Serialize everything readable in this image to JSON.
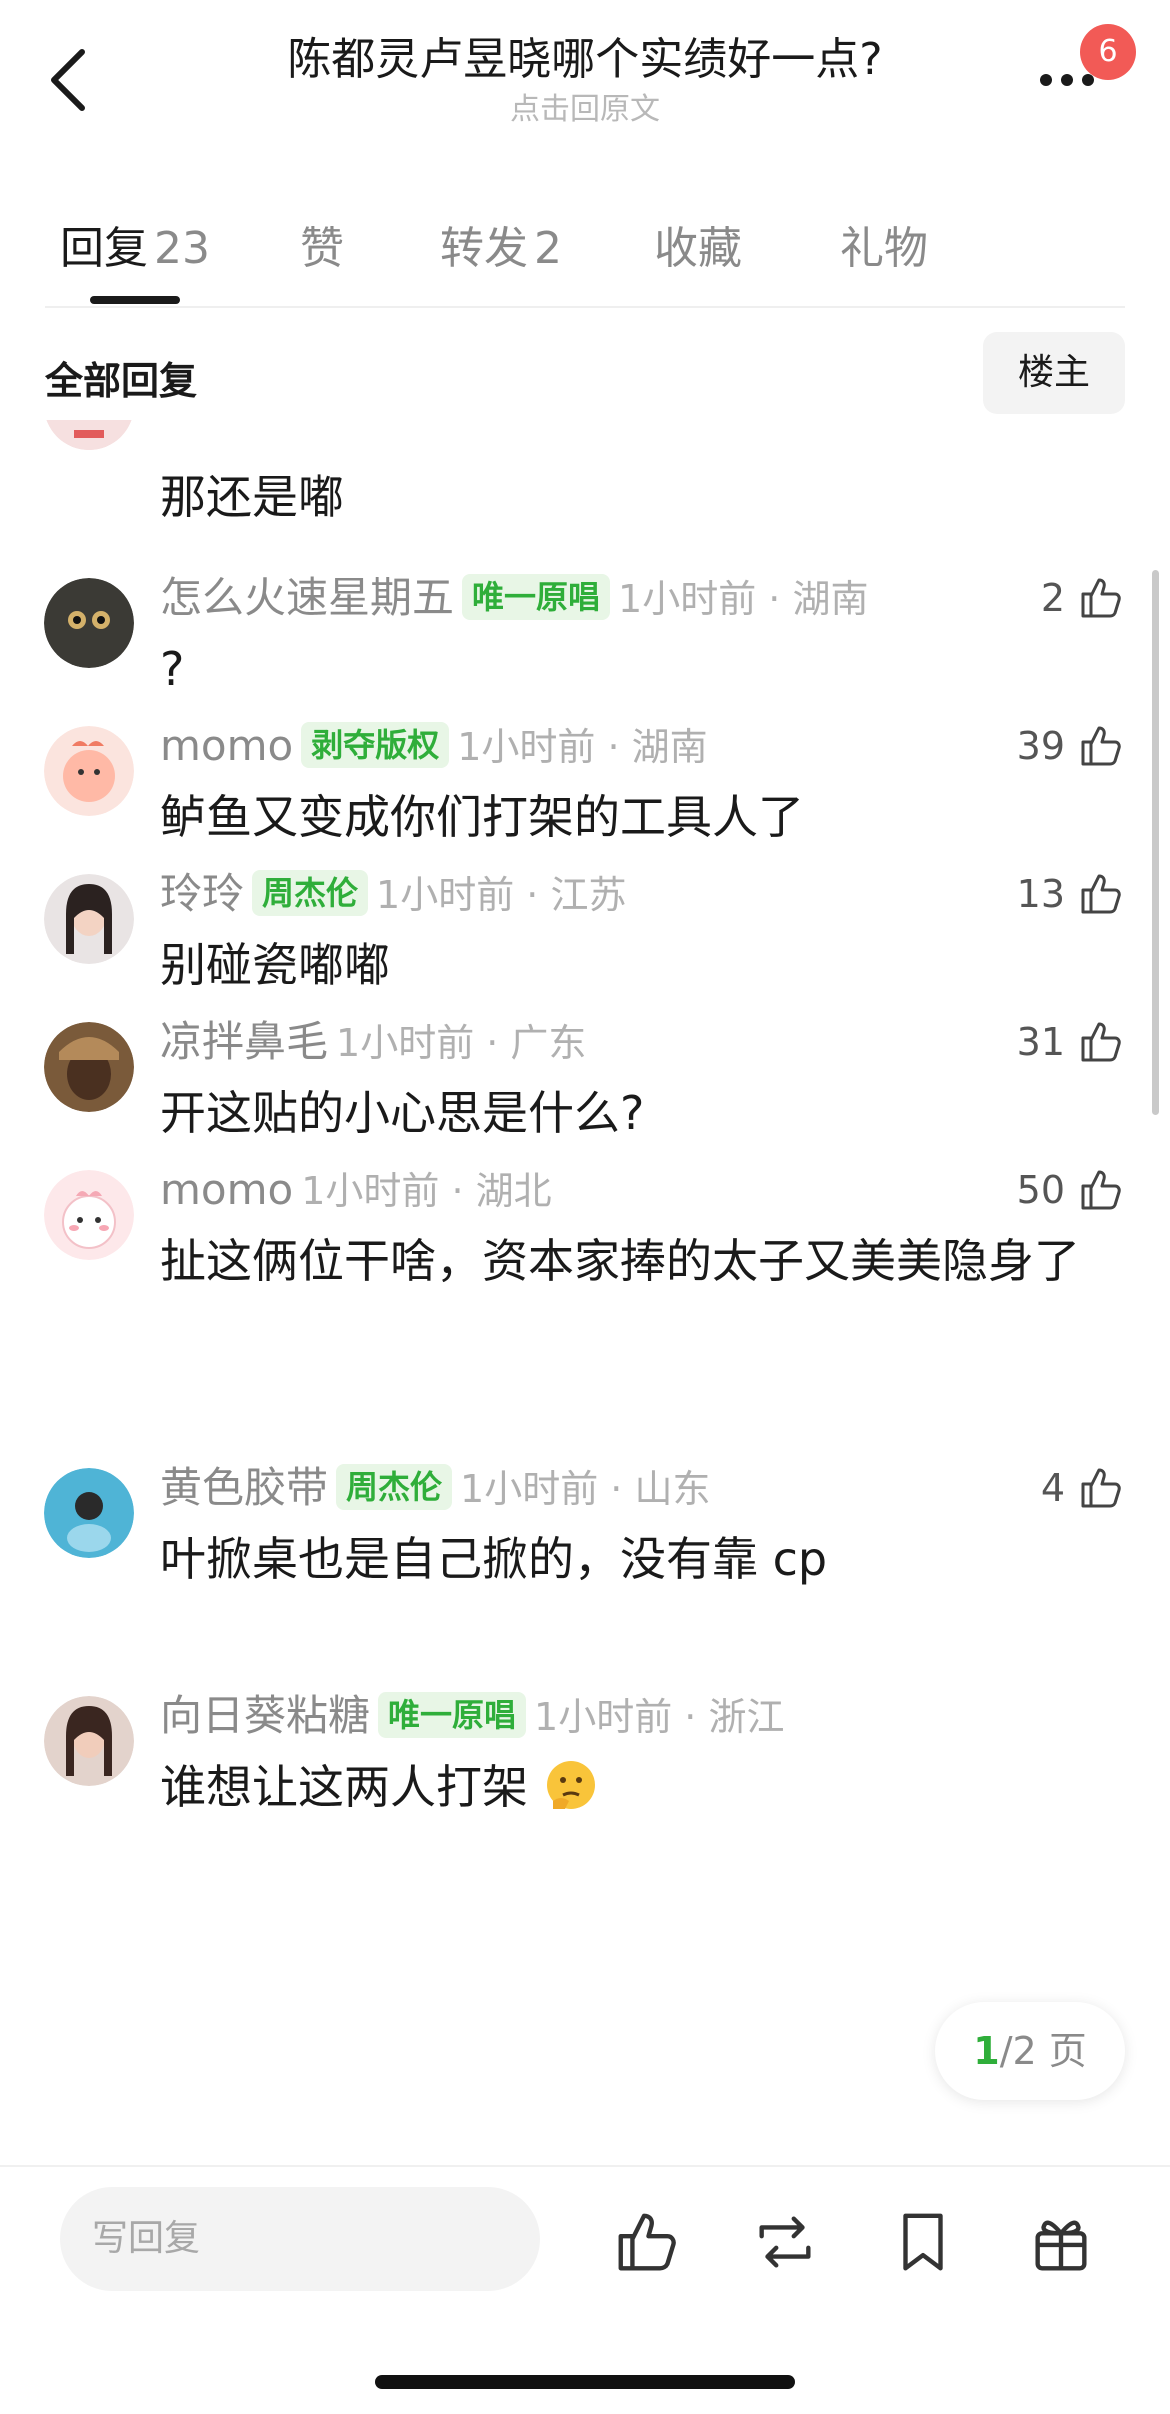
{
  "header": {
    "title": "陈都灵卢昱晓哪个实绩好一点?",
    "subtitle": "点击回原文",
    "notification_count": "6"
  },
  "tabs": [
    {
      "label": "回复",
      "count": "23",
      "active": true
    },
    {
      "label": "赞",
      "count": "",
      "active": false
    },
    {
      "label": "转发",
      "count": "2",
      "active": false
    },
    {
      "label": "收藏",
      "count": "",
      "active": false
    },
    {
      "label": "礼物",
      "count": "",
      "active": false
    }
  ],
  "filter": {
    "title": "全部回复",
    "owner_button": "楼主"
  },
  "comments": [
    {
      "username": "",
      "tag": "",
      "meta": "",
      "likes": "",
      "text": "那还是嘟"
    },
    {
      "username": "怎么火速星期五",
      "tag": "唯一原唱",
      "meta": "1小时前 · 湖南",
      "likes": "2",
      "text": "?"
    },
    {
      "username": "momo",
      "tag": "剥夺版权",
      "meta": "1小时前 · 湖南",
      "likes": "39",
      "text": "鲈鱼又变成你们打架的工具人了"
    },
    {
      "username": "玲玲",
      "tag": "周杰伦",
      "meta": "1小时前 · 江苏",
      "likes": "13",
      "text": "别碰瓷嘟嘟"
    },
    {
      "username": "凉拌鼻毛",
      "tag": "",
      "meta": "1小时前 · 广东",
      "likes": "31",
      "text": "开这贴的小心思是什么?"
    },
    {
      "username": "momo",
      "tag": "",
      "meta": "1小时前 · 湖北",
      "likes": "50",
      "text": "扯这俩位干啥，资本家捧的太子又美美隐身了"
    },
    {
      "username": "黄色胶带",
      "tag": "周杰伦",
      "meta": "1小时前 · 山东",
      "likes": "4",
      "text": "叶掀桌也是自己掀的，没有靠 cp"
    },
    {
      "username": "向日葵粘糖",
      "tag": "唯一原唱",
      "meta": "1小时前 · 浙江",
      "likes": "",
      "text": "谁想让这两人打架"
    }
  ],
  "pager": {
    "current": "1",
    "total": "/2 页"
  },
  "bottom_bar": {
    "reply_placeholder": "写回复",
    "icons": [
      "like-icon",
      "repost-icon",
      "bookmark-icon",
      "gift-icon"
    ]
  },
  "colors": {
    "accent_green": "#2fae3a",
    "tag_bg": "#e8f6e6",
    "badge_red": "#f25a56"
  }
}
